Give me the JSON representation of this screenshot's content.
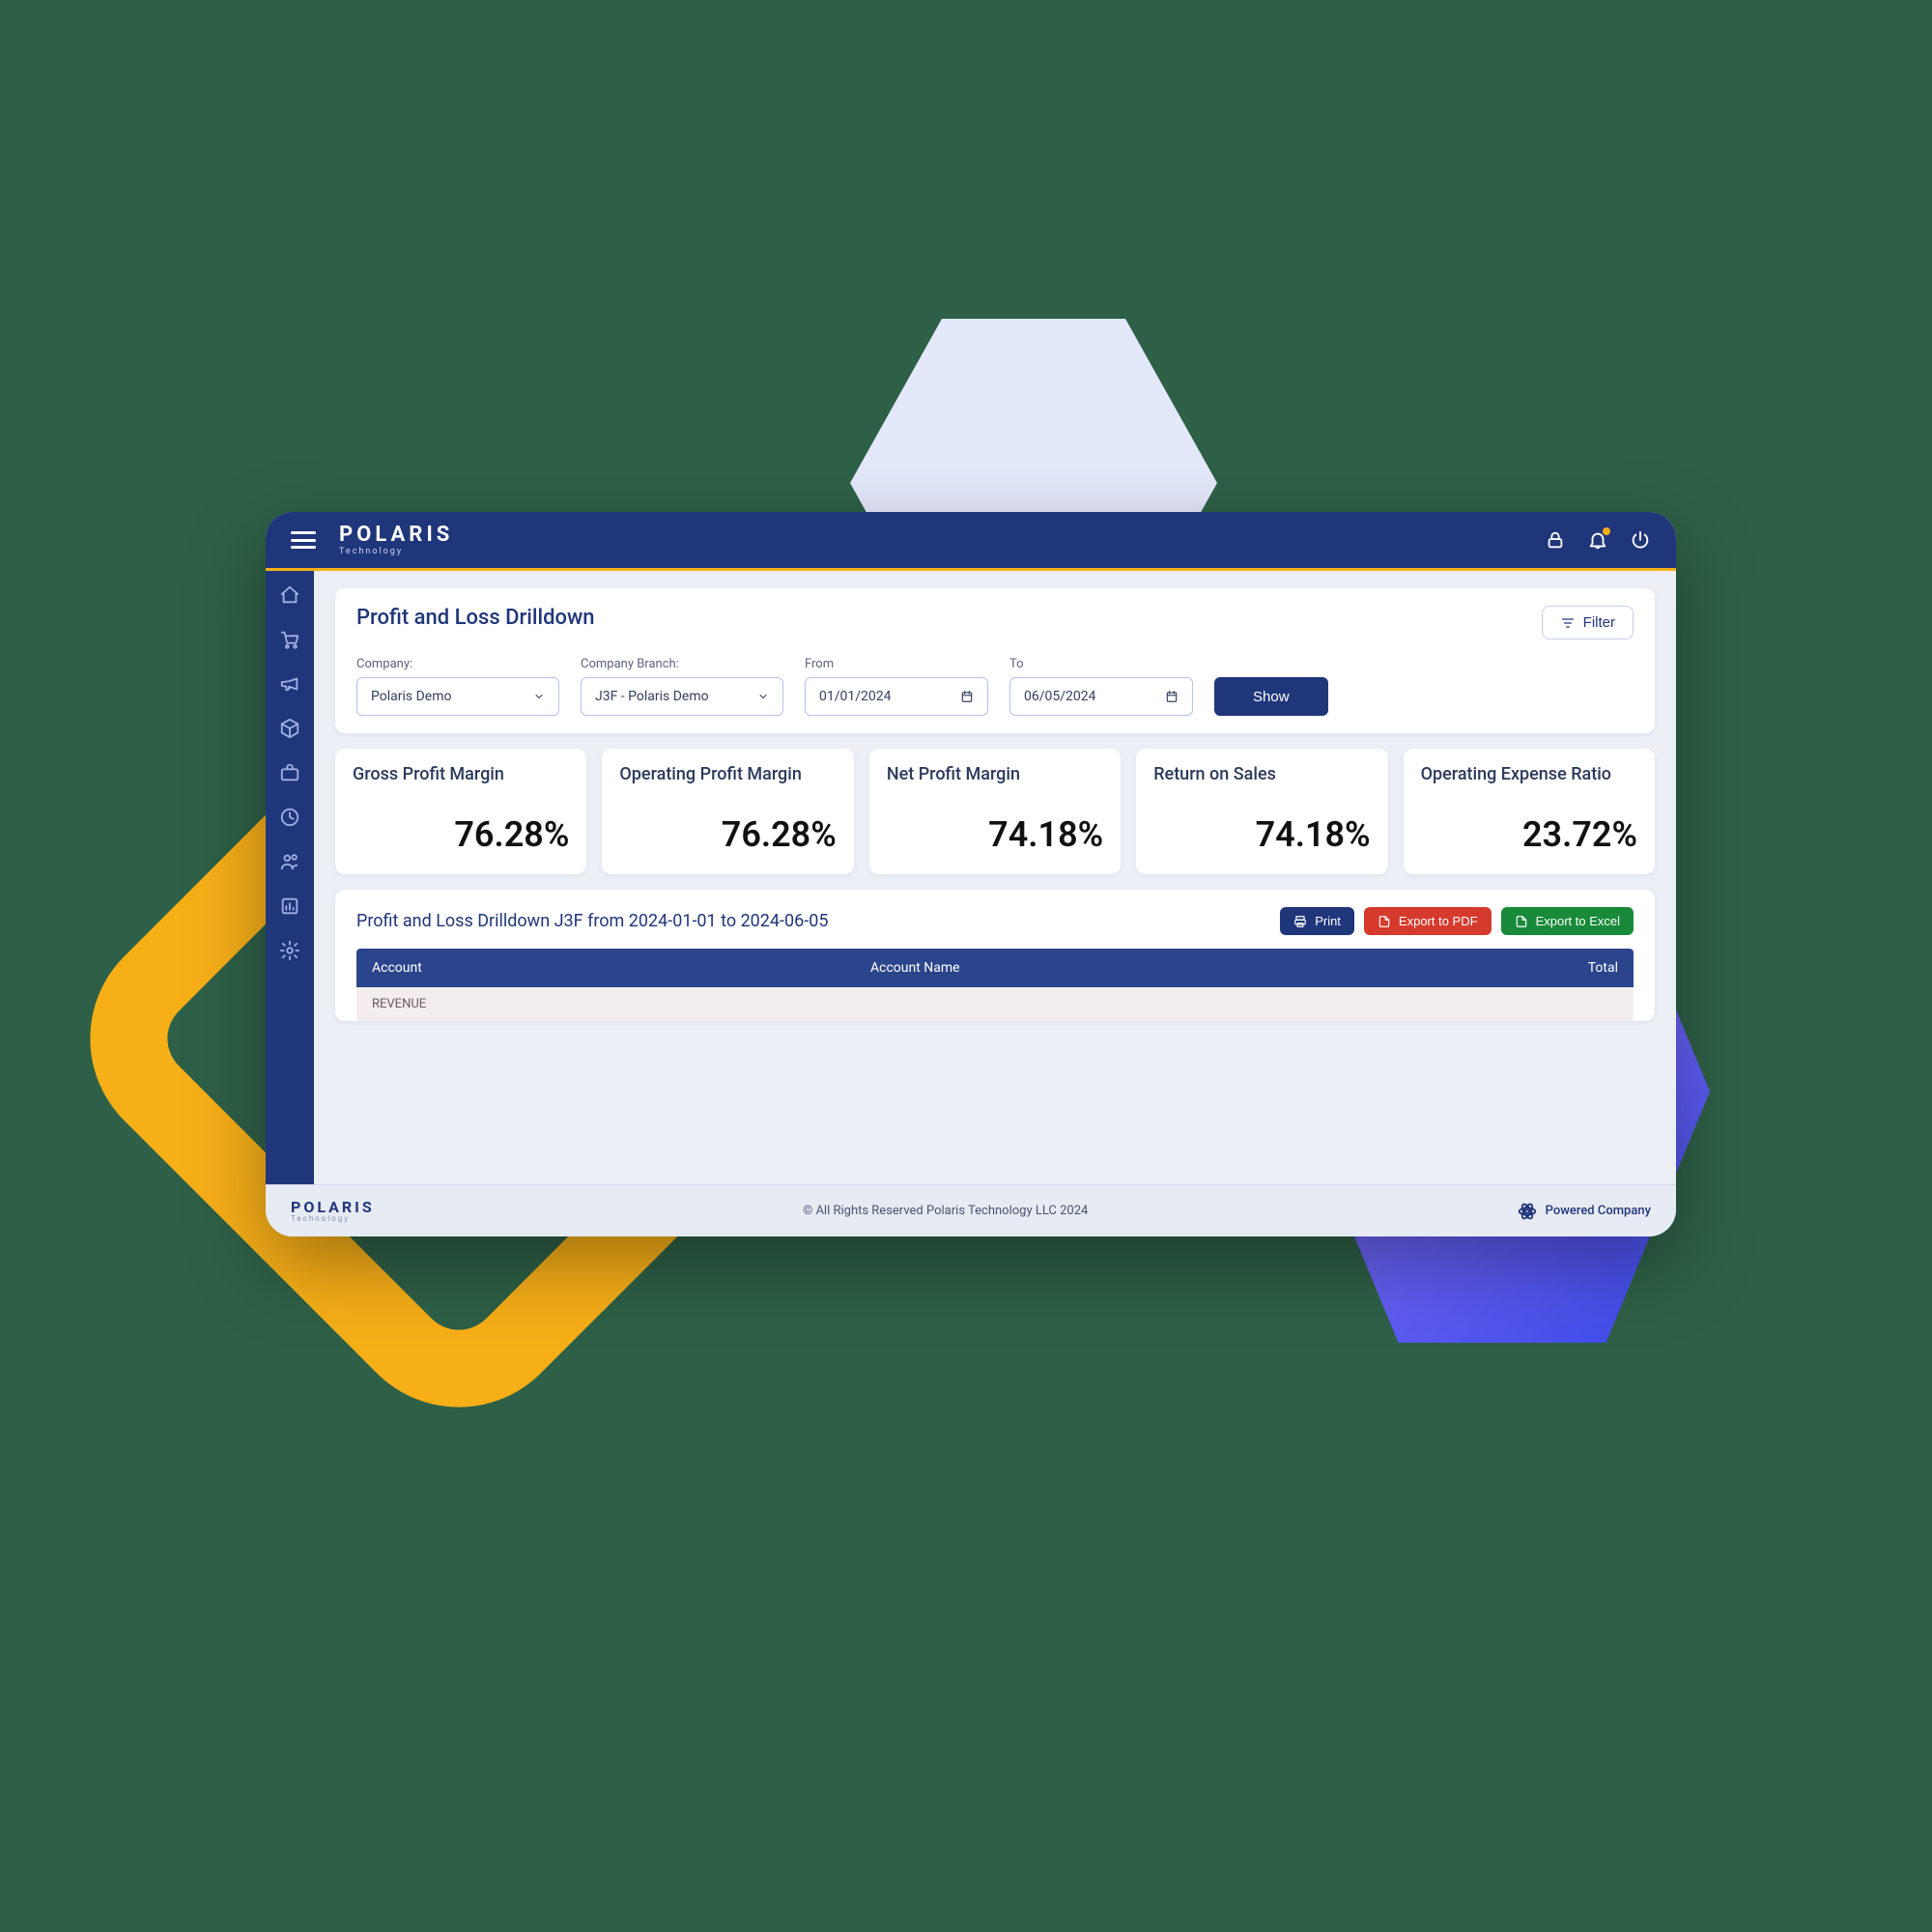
{
  "brand": {
    "name": "POLARIS",
    "sub": "Technology"
  },
  "header_icons": [
    "lock-icon",
    "bell-icon",
    "power-icon"
  ],
  "sidebar_icons": [
    "home-icon",
    "cart-icon",
    "megaphone-icon",
    "cube-icon",
    "briefcase-icon",
    "clock-icon",
    "users-icon",
    "bar-chart-icon",
    "settings-icon"
  ],
  "page": {
    "title": "Profit and Loss Drilldown",
    "filter_button": "Filter",
    "fields": {
      "company": {
        "label": "Company:",
        "value": "Polaris Demo"
      },
      "branch": {
        "label": "Company Branch:",
        "value": "J3F - Polaris Demo"
      },
      "from": {
        "label": "From",
        "value": "01/01/2024"
      },
      "to": {
        "label": "To",
        "value": "06/05/2024"
      }
    },
    "show_button": "Show"
  },
  "kpis": [
    {
      "label": "Gross Profit Margin",
      "value": "76.28%"
    },
    {
      "label": "Operating Profit Margin",
      "value": "76.28%"
    },
    {
      "label": "Net Profit Margin",
      "value": "74.18%"
    },
    {
      "label": "Return on Sales",
      "value": "74.18%"
    },
    {
      "label": "Operating Expense Ratio",
      "value": "23.72%"
    }
  ],
  "report": {
    "title": "Profit and Loss Drilldown J3F from 2024-01-01 to 2024-06-05",
    "buttons": {
      "print": "Print",
      "pdf": "Export to PDF",
      "xls": "Export to Excel"
    },
    "columns": {
      "account": "Account",
      "account_name": "Account Name",
      "total": "Total"
    },
    "rows": [
      {
        "account": "REVENUE"
      }
    ]
  },
  "footer": {
    "copyright": "© All Rights Reserved Polaris Technology LLC 2024",
    "powered": "Powered Company"
  }
}
